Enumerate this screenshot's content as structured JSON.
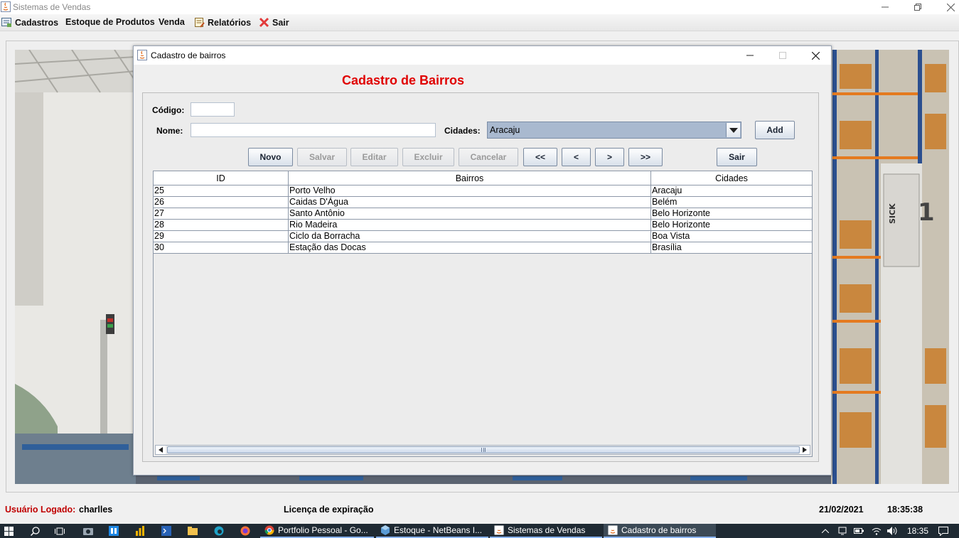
{
  "app": {
    "title": "Sistemas de Vendas"
  },
  "menubar": {
    "items": [
      {
        "label": "Cadastros",
        "icon": "registry-icon"
      },
      {
        "label": "Estoque de Produtos"
      },
      {
        "label": "Venda"
      },
      {
        "label": "Relatórios",
        "icon": "report-icon"
      },
      {
        "label": "Sair",
        "icon": "close-red-icon"
      }
    ]
  },
  "dialog": {
    "title": "Cadastro de bairros",
    "heading": "Cadastro de Bairros",
    "heading_color": "#e00000",
    "fields": {
      "codigo_label": "Código:",
      "codigo_value": "",
      "nome_label": "Nome:",
      "nome_value": "",
      "cidades_label": "Cidades:",
      "cidades_selected": "Aracaju"
    },
    "buttons": {
      "add": "Add",
      "novo": "Novo",
      "salvar": "Salvar",
      "editar": "Editar",
      "excluir": "Excluir",
      "cancelar": "Cancelar",
      "first": "<<",
      "prev": "<",
      "next": ">",
      "last": ">>",
      "sair": "Sair"
    },
    "table": {
      "columns": [
        "ID",
        "Bairros",
        "Cidades"
      ],
      "rows": [
        [
          "25",
          "Porto Velho",
          "Aracaju"
        ],
        [
          "26",
          "Caidas D'Água",
          "Belém"
        ],
        [
          "27",
          "Santo Antônio",
          "Belo Horizonte"
        ],
        [
          "28",
          "Rio Madeira",
          "Belo Horizonte"
        ],
        [
          "29",
          "Ciclo da Borracha",
          "Boa Vista"
        ],
        [
          "30",
          "Estação das Docas",
          "Brasília"
        ]
      ]
    }
  },
  "statusbar": {
    "user_label": "Usuário Logado:",
    "user_value": "charlles",
    "license": "Licença de expiração",
    "date": "21/02/2021",
    "time": "18:35:38",
    "user_label_color": "#c00000"
  },
  "taskbar": {
    "apps": [
      {
        "label": "Portfolio Pessoal - Go...",
        "icon": "chrome-icon"
      },
      {
        "label": "Estoque - NetBeans I...",
        "icon": "netbeans-icon"
      },
      {
        "label": "Sistemas de Vendas",
        "icon": "java-icon"
      },
      {
        "label": "Cadastro de bairros",
        "icon": "java-icon"
      }
    ],
    "clock": "18:35"
  }
}
